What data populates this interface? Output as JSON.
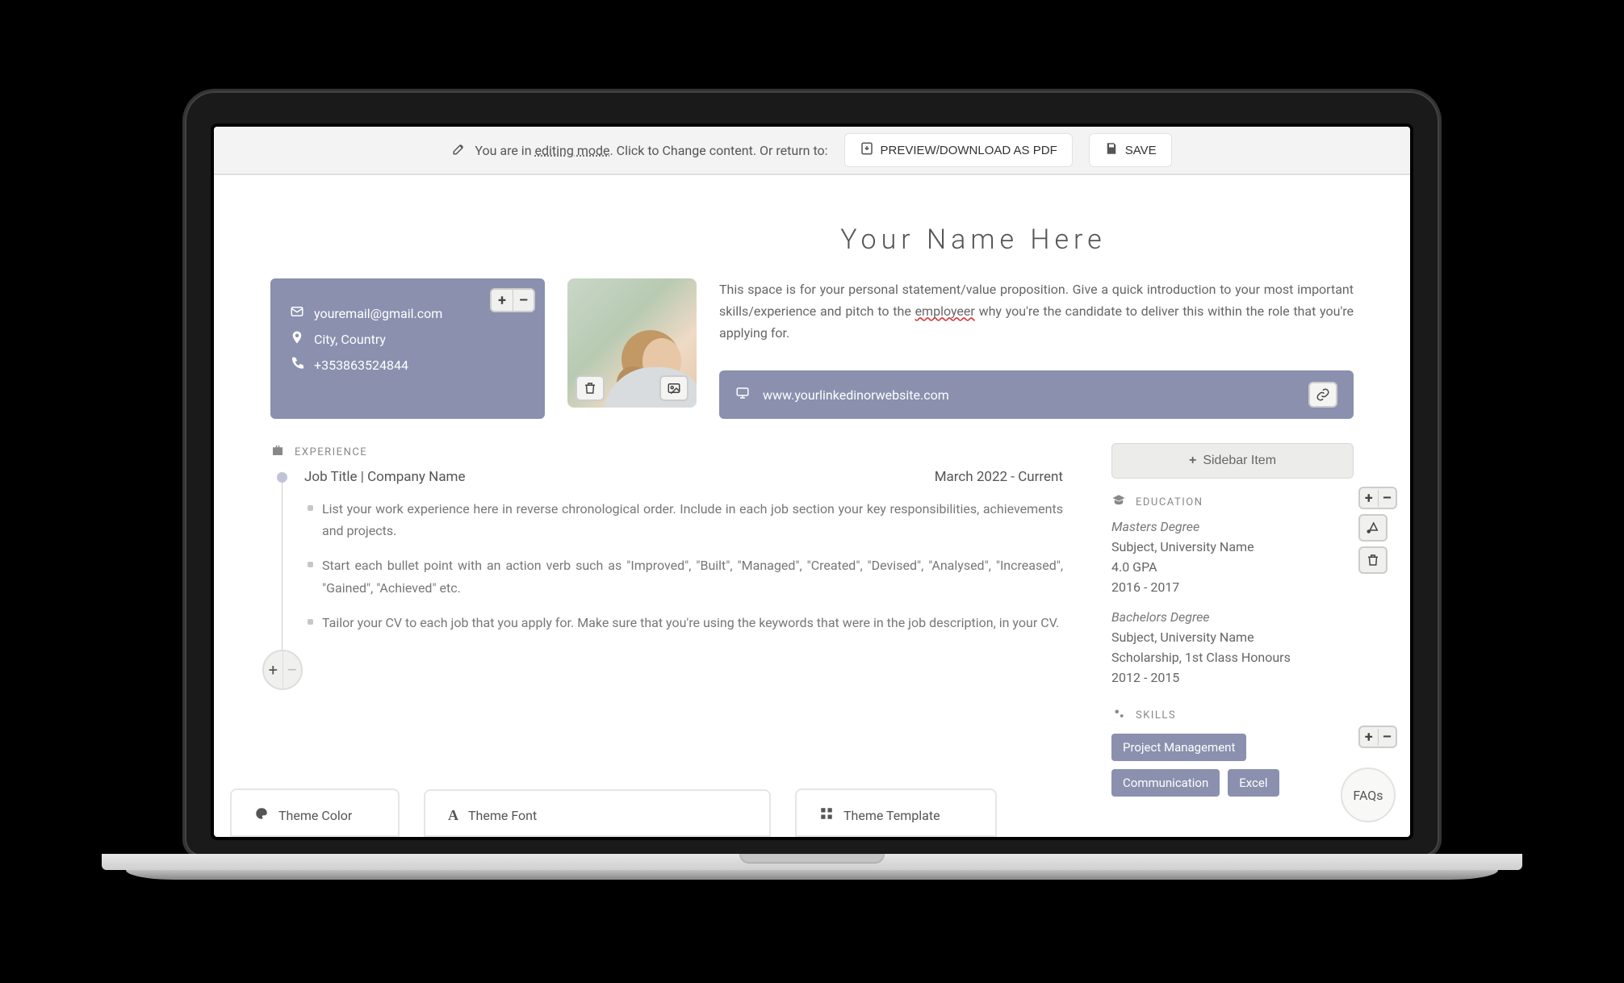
{
  "topbar": {
    "prefix": "You are in ",
    "mode": "editing mode",
    "suffix": ". Click to Change content. Or return to:",
    "preview_btn": "PREVIEW/DOWNLOAD AS PDF",
    "save_btn": "SAVE"
  },
  "resume": {
    "name": "Your Name Here",
    "contact": {
      "email": "youremail@gmail.com",
      "location": "City, Country",
      "phone": "+353863524844"
    },
    "statement": {
      "part1": "This space is for your personal statement/value proposition. Give a quick introduction to your most important skills/experience and pitch to the ",
      "misspelled": "employeer",
      "part2": " why you're the candidate to deliver this within the role that you're applying for."
    },
    "link": "www.yourlinkedinorwebsite.com",
    "experience": {
      "heading": "EXPERIENCE",
      "job_title_line": "Job Title | Company Name",
      "date_range": "March 2022 - Current",
      "bullets": [
        "List your work experience here in reverse chronological order. Include in each job section your key responsibilities, achievements and projects.",
        "Start each bullet point with an action verb such as \"Improved\", \"Built\", \"Managed\", \"Created\", \"Devised\", \"Analysed\", \"Increased\", \"Gained\", \"Achieved\" etc.",
        "Tailor your CV to each job that you apply for. Make sure that you're using the keywords that were in the job description, in your CV."
      ]
    },
    "sidebar_add": "Sidebar Item",
    "education": {
      "heading": "EDUCATION",
      "items": [
        {
          "degree": "Masters Degree",
          "subject": "Subject, University Name",
          "extra": "4.0 GPA",
          "years": "2016 - 2017"
        },
        {
          "degree": "Bachelors Degree",
          "subject": "Subject, University Name",
          "extra": "Scholarship, 1st Class Honours",
          "years": "2012 - 2015"
        }
      ]
    },
    "skills": {
      "heading": "SKILLS",
      "tags": [
        "Project Management",
        "Communication",
        "Excel"
      ]
    }
  },
  "theme": {
    "color": "Theme Color",
    "font": "Theme Font",
    "template": "Theme Template"
  },
  "faqs": "FAQs"
}
